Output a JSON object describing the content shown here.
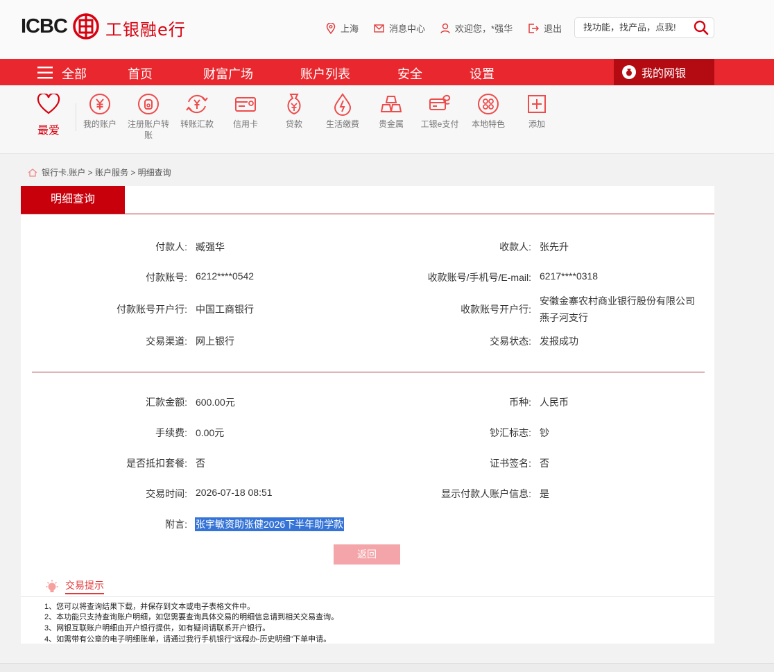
{
  "header": {
    "logo_text": "ICBC",
    "slogan": "工银融e行",
    "location": "上海",
    "messages": "消息中心",
    "welcome": "欢迎您，*强华",
    "logout": "退出",
    "search_placeholder": "找功能，找产品，点我!"
  },
  "nav": {
    "all": "全部",
    "items": [
      "首页",
      "财富广场",
      "账户列表",
      "安全",
      "设置"
    ],
    "mybank": "我的网银"
  },
  "quick": {
    "fav": "最爱",
    "items": [
      {
        "label": "我的账户",
        "icon": "yuan-coin-icon"
      },
      {
        "label": "注册账户转账",
        "icon": "transfer-coin-icon"
      },
      {
        "label": "转账汇款",
        "icon": "remit-icon"
      },
      {
        "label": "信用卡",
        "icon": "credit-card-icon"
      },
      {
        "label": "贷款",
        "icon": "money-bag-icon"
      },
      {
        "label": "生活缴费",
        "icon": "utility-drop-icon"
      },
      {
        "label": "贵金属",
        "icon": "gold-bars-icon"
      },
      {
        "label": "工银e支付",
        "icon": "epay-icon"
      },
      {
        "label": "本地特色",
        "icon": "local-icon"
      },
      {
        "label": "添加",
        "icon": "add-icon"
      }
    ]
  },
  "breadcrumb": "银行卡.账户 > 账户服务 > 明细查询",
  "panel": {
    "tab": "明细查询",
    "payer_label": "付款人:",
    "payer": "臧强华",
    "payee_label": "收款人:",
    "payee": "张先升",
    "payer_acct_label": "付款账号:",
    "payer_acct": "6212****0542",
    "payee_acct_label": "收款账号/手机号/E-mail:",
    "payee_acct": "6217****0318",
    "payer_bank_label": "付款账号开户行:",
    "payer_bank": "中国工商银行",
    "payee_bank_label": "收款账号开户行:",
    "payee_bank_line1": "安徽金寨农村商业银行股份有限公司",
    "payee_bank_line2": "燕子河支行",
    "channel_label": "交易渠道:",
    "channel": "网上银行",
    "status_label": "交易状态:",
    "status": "发报成功",
    "amount_label": "汇款金额:",
    "amount": "600.00元",
    "currency_label": "币种:",
    "currency": "人民币",
    "fee_label": "手续费:",
    "fee": "0.00元",
    "cash_label": "钞汇标志:",
    "cash": "钞",
    "package_label": "是否抵扣套餐:",
    "package": "否",
    "cert_label": "证书签名:",
    "cert": "否",
    "time_label": "交易时间:",
    "time": "2026-07-18 08:51",
    "show_payer_label": "显示付款人账户信息:",
    "show_payer": "是",
    "remark_label": "附言:",
    "remark": "张宇敏资助张健2026下半年助学款",
    "back": "返回"
  },
  "tips": {
    "title": "交易提示",
    "lines": [
      "1、您可以将查询结果下载，并保存到文本或电子表格文件中。",
      "2、本功能只支持查询账户明细，如您需要查询具体交易的明细信息请到相关交易查询。",
      "3、网银互联账户明细由开户银行提供，如有疑问请联系开户银行。",
      "4、如需带有公章的电子明细账单，请通过我行手机银行“远程办-历史明细”下单申请。"
    ]
  },
  "colors": {
    "brand_red": "#e8282e",
    "dark_red": "#b40b13",
    "tab_red": "#c8000c"
  }
}
